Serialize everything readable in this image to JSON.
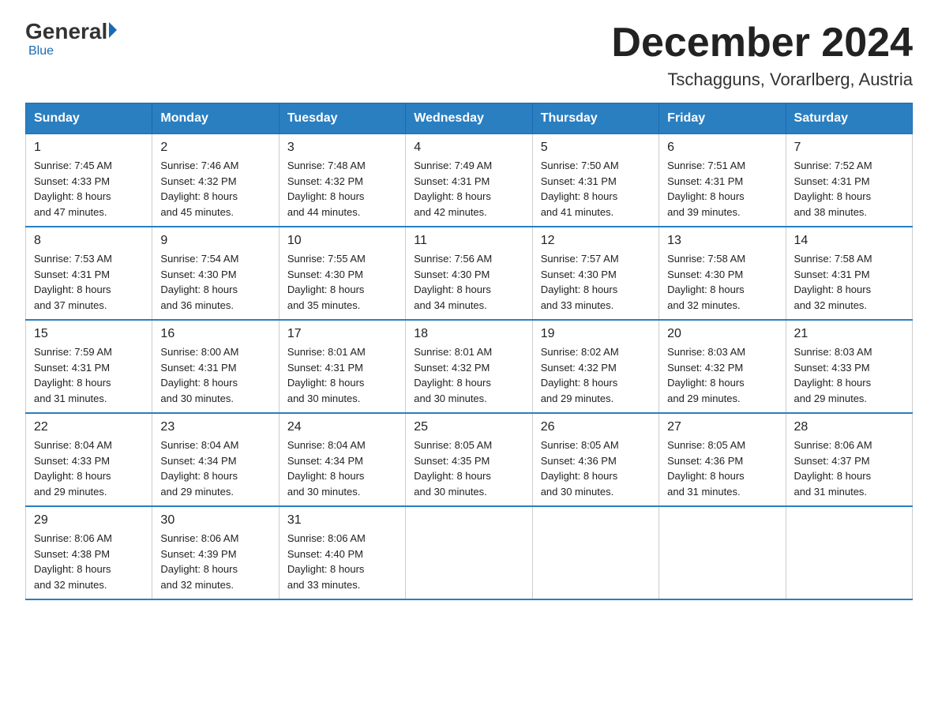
{
  "logo": {
    "general": "General",
    "blue": "Blue"
  },
  "title": "December 2024",
  "location": "Tschagguns, Vorarlberg, Austria",
  "days_of_week": [
    "Sunday",
    "Monday",
    "Tuesday",
    "Wednesday",
    "Thursday",
    "Friday",
    "Saturday"
  ],
  "weeks": [
    [
      {
        "day": "1",
        "sunrise": "7:45 AM",
        "sunset": "4:33 PM",
        "daylight": "8 hours and 47 minutes."
      },
      {
        "day": "2",
        "sunrise": "7:46 AM",
        "sunset": "4:32 PM",
        "daylight": "8 hours and 45 minutes."
      },
      {
        "day": "3",
        "sunrise": "7:48 AM",
        "sunset": "4:32 PM",
        "daylight": "8 hours and 44 minutes."
      },
      {
        "day": "4",
        "sunrise": "7:49 AM",
        "sunset": "4:31 PM",
        "daylight": "8 hours and 42 minutes."
      },
      {
        "day": "5",
        "sunrise": "7:50 AM",
        "sunset": "4:31 PM",
        "daylight": "8 hours and 41 minutes."
      },
      {
        "day": "6",
        "sunrise": "7:51 AM",
        "sunset": "4:31 PM",
        "daylight": "8 hours and 39 minutes."
      },
      {
        "day": "7",
        "sunrise": "7:52 AM",
        "sunset": "4:31 PM",
        "daylight": "8 hours and 38 minutes."
      }
    ],
    [
      {
        "day": "8",
        "sunrise": "7:53 AM",
        "sunset": "4:31 PM",
        "daylight": "8 hours and 37 minutes."
      },
      {
        "day": "9",
        "sunrise": "7:54 AM",
        "sunset": "4:30 PM",
        "daylight": "8 hours and 36 minutes."
      },
      {
        "day": "10",
        "sunrise": "7:55 AM",
        "sunset": "4:30 PM",
        "daylight": "8 hours and 35 minutes."
      },
      {
        "day": "11",
        "sunrise": "7:56 AM",
        "sunset": "4:30 PM",
        "daylight": "8 hours and 34 minutes."
      },
      {
        "day": "12",
        "sunrise": "7:57 AM",
        "sunset": "4:30 PM",
        "daylight": "8 hours and 33 minutes."
      },
      {
        "day": "13",
        "sunrise": "7:58 AM",
        "sunset": "4:30 PM",
        "daylight": "8 hours and 32 minutes."
      },
      {
        "day": "14",
        "sunrise": "7:58 AM",
        "sunset": "4:31 PM",
        "daylight": "8 hours and 32 minutes."
      }
    ],
    [
      {
        "day": "15",
        "sunrise": "7:59 AM",
        "sunset": "4:31 PM",
        "daylight": "8 hours and 31 minutes."
      },
      {
        "day": "16",
        "sunrise": "8:00 AM",
        "sunset": "4:31 PM",
        "daylight": "8 hours and 30 minutes."
      },
      {
        "day": "17",
        "sunrise": "8:01 AM",
        "sunset": "4:31 PM",
        "daylight": "8 hours and 30 minutes."
      },
      {
        "day": "18",
        "sunrise": "8:01 AM",
        "sunset": "4:32 PM",
        "daylight": "8 hours and 30 minutes."
      },
      {
        "day": "19",
        "sunrise": "8:02 AM",
        "sunset": "4:32 PM",
        "daylight": "8 hours and 29 minutes."
      },
      {
        "day": "20",
        "sunrise": "8:03 AM",
        "sunset": "4:32 PM",
        "daylight": "8 hours and 29 minutes."
      },
      {
        "day": "21",
        "sunrise": "8:03 AM",
        "sunset": "4:33 PM",
        "daylight": "8 hours and 29 minutes."
      }
    ],
    [
      {
        "day": "22",
        "sunrise": "8:04 AM",
        "sunset": "4:33 PM",
        "daylight": "8 hours and 29 minutes."
      },
      {
        "day": "23",
        "sunrise": "8:04 AM",
        "sunset": "4:34 PM",
        "daylight": "8 hours and 29 minutes."
      },
      {
        "day": "24",
        "sunrise": "8:04 AM",
        "sunset": "4:34 PM",
        "daylight": "8 hours and 30 minutes."
      },
      {
        "day": "25",
        "sunrise": "8:05 AM",
        "sunset": "4:35 PM",
        "daylight": "8 hours and 30 minutes."
      },
      {
        "day": "26",
        "sunrise": "8:05 AM",
        "sunset": "4:36 PM",
        "daylight": "8 hours and 30 minutes."
      },
      {
        "day": "27",
        "sunrise": "8:05 AM",
        "sunset": "4:36 PM",
        "daylight": "8 hours and 31 minutes."
      },
      {
        "day": "28",
        "sunrise": "8:06 AM",
        "sunset": "4:37 PM",
        "daylight": "8 hours and 31 minutes."
      }
    ],
    [
      {
        "day": "29",
        "sunrise": "8:06 AM",
        "sunset": "4:38 PM",
        "daylight": "8 hours and 32 minutes."
      },
      {
        "day": "30",
        "sunrise": "8:06 AM",
        "sunset": "4:39 PM",
        "daylight": "8 hours and 32 minutes."
      },
      {
        "day": "31",
        "sunrise": "8:06 AM",
        "sunset": "4:40 PM",
        "daylight": "8 hours and 33 minutes."
      },
      null,
      null,
      null,
      null
    ]
  ],
  "labels": {
    "sunrise": "Sunrise:",
    "sunset": "Sunset:",
    "daylight": "Daylight:"
  }
}
